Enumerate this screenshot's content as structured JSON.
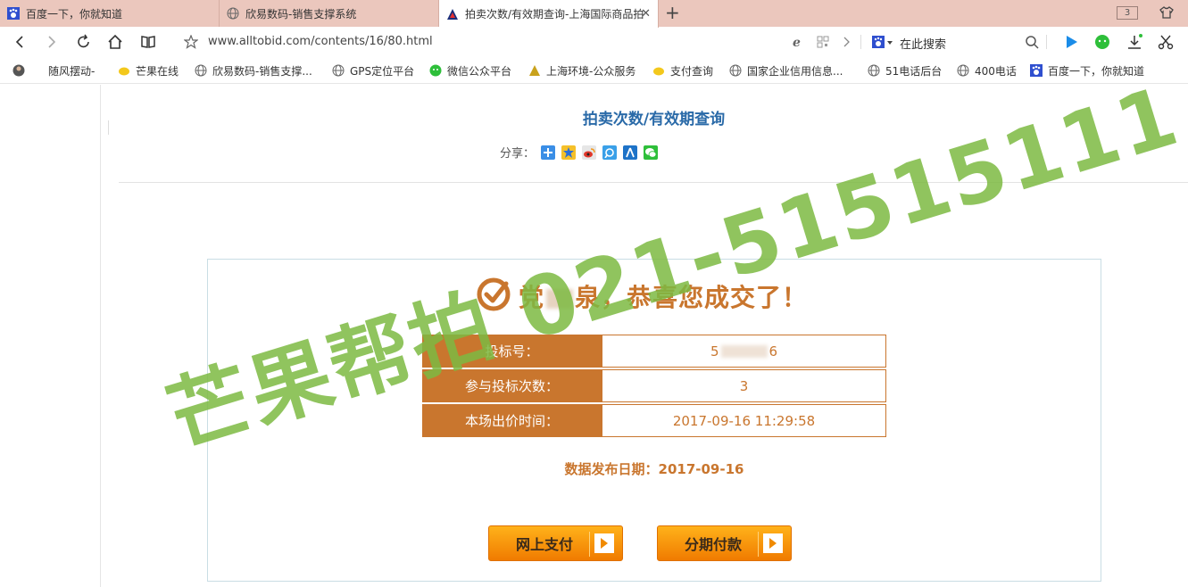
{
  "tabs": [
    {
      "label": "百度一下，你就知道",
      "icon": "paw-icon"
    },
    {
      "label": "欣易数码-销售支撑系统",
      "icon": "globe-icon"
    },
    {
      "label": "拍卖次数/有效期查询-上海国际商品拍",
      "icon": "triangle-logo-icon",
      "active": true
    }
  ],
  "tab_count": "3",
  "address": {
    "url": "www.alltobid.com/contents/16/80.html",
    "search_placeholder": "在此搜索"
  },
  "bookmarks": [
    {
      "label": "随风摆动-",
      "icon": "avatar-icon"
    },
    {
      "label": "芒果在线",
      "icon": "lemon-icon"
    },
    {
      "label": "欣易数码-销售支撑...",
      "icon": "globe-icon"
    },
    {
      "label": "GPS定位平台",
      "icon": "globe-icon"
    },
    {
      "label": "微信公众平台",
      "icon": "wechat-icon"
    },
    {
      "label": "上海环境-公众服务",
      "icon": "building-icon"
    },
    {
      "label": "支付查询",
      "icon": "lemon-icon"
    },
    {
      "label": "国家企业信用信息...",
      "icon": "globe-icon"
    },
    {
      "label": "51电话后台",
      "icon": "globe-icon"
    },
    {
      "label": "400电话",
      "icon": "globe-icon"
    },
    {
      "label": "百度一下，你就知道",
      "icon": "paw-icon"
    }
  ],
  "page": {
    "title": "拍卖次数/有效期查询",
    "share_label": "分享：",
    "congrats_prefix": "党",
    "congrats_suffix": "泉，恭喜您成交了！",
    "rows": [
      {
        "label": "投标号：",
        "value_prefix": "5",
        "value_suffix": "6"
      },
      {
        "label": "参与投标次数：",
        "value": "3"
      },
      {
        "label": "本场出价时间：",
        "value": "2017-09-16 11:29:58"
      }
    ],
    "pubdate": "数据发布日期：2017-09-16",
    "pay_online": "网上支付",
    "installment": "分期付款"
  },
  "watermark": "芒果帮拍 021-51515111",
  "colors": {
    "accent": "#c9762e",
    "title_blue": "#2a6aa8",
    "tabbar": "#ebc7bd",
    "watermark": "#7cba42",
    "button": "#f59400"
  }
}
